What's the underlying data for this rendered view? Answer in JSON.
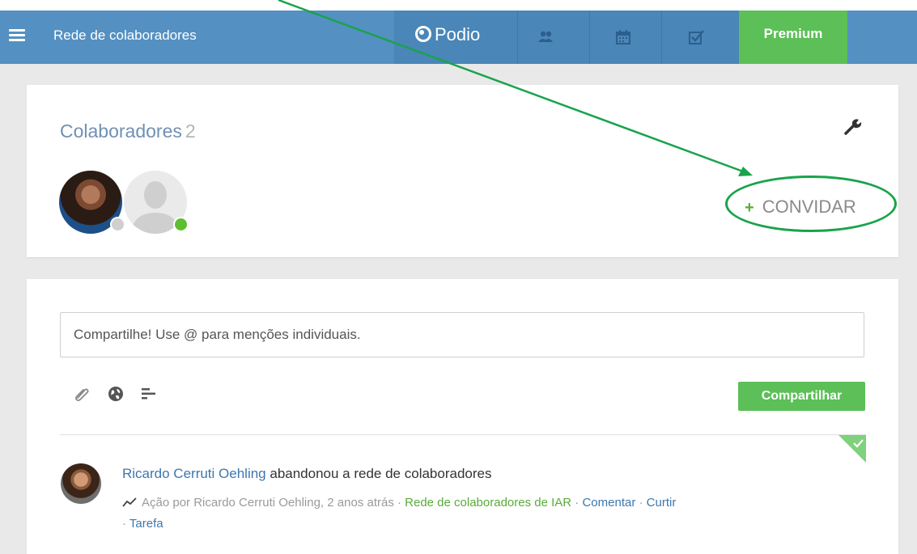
{
  "nav": {
    "title": "Rede de colaboradores",
    "logo_text": "Podio",
    "premium_label": "Premium",
    "icons": [
      "contacts-icon",
      "calendar-icon",
      "tasks-icon"
    ]
  },
  "collaborators": {
    "title": "Colaboradores",
    "count": "2",
    "invite_label": "CONVIDAR",
    "invite_plus": "+"
  },
  "share": {
    "placeholder": "Compartilhe! Use @ para menções individuais.",
    "button_label": "Compartilhar",
    "tools": [
      "paperclip-icon",
      "globe-icon",
      "list-icon"
    ]
  },
  "activity": {
    "user": "Ricardo Cerruti Oehling",
    "action": " abandonou a rede de colaboradores",
    "meta_prefix": "Ação por Ricardo Cerruti Oehling, 2 anos atrás · ",
    "workspace_link": "Rede de colaboradores de IAR",
    "sep1": " · ",
    "comment_link": "Comentar",
    "sep2": " · ",
    "like_link": "Curtir",
    "sep3": " · ",
    "task_link": "Tarefa"
  },
  "colors": {
    "nav_bg": "#5490c1",
    "accent_green": "#5cbf57",
    "annotation_green": "#19a34b",
    "link_blue": "#3d77ad"
  }
}
